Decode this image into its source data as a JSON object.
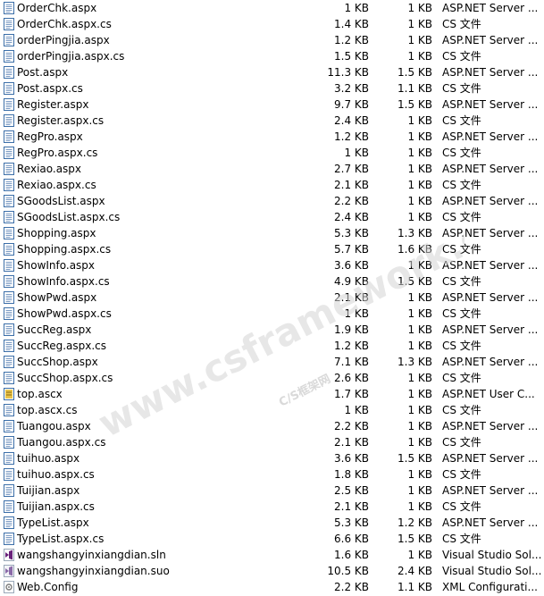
{
  "files": [
    {
      "name": "OrderChk.aspx",
      "size": "1 KB",
      "compressed": "1 KB",
      "type": "ASP.NET Server ...",
      "icon": "aspx-file-icon"
    },
    {
      "name": "OrderChk.aspx.cs",
      "size": "1.4 KB",
      "compressed": "1 KB",
      "type": "CS 文件",
      "icon": "cs-file-icon"
    },
    {
      "name": "orderPingjia.aspx",
      "size": "1.2 KB",
      "compressed": "1 KB",
      "type": "ASP.NET Server ...",
      "icon": "aspx-file-icon"
    },
    {
      "name": "orderPingjia.aspx.cs",
      "size": "1.5 KB",
      "compressed": "1 KB",
      "type": "CS 文件",
      "icon": "cs-file-icon"
    },
    {
      "name": "Post.aspx",
      "size": "11.3 KB",
      "compressed": "1.5 KB",
      "type": "ASP.NET Server ...",
      "icon": "aspx-file-icon"
    },
    {
      "name": "Post.aspx.cs",
      "size": "3.2 KB",
      "compressed": "1.1 KB",
      "type": "CS 文件",
      "icon": "cs-file-icon"
    },
    {
      "name": "Register.aspx",
      "size": "9.7 KB",
      "compressed": "1.5 KB",
      "type": "ASP.NET Server ...",
      "icon": "aspx-file-icon"
    },
    {
      "name": "Register.aspx.cs",
      "size": "2.4 KB",
      "compressed": "1 KB",
      "type": "CS 文件",
      "icon": "cs-file-icon"
    },
    {
      "name": "RegPro.aspx",
      "size": "1.2 KB",
      "compressed": "1 KB",
      "type": "ASP.NET Server ...",
      "icon": "aspx-file-icon"
    },
    {
      "name": "RegPro.aspx.cs",
      "size": "1 KB",
      "compressed": "1 KB",
      "type": "CS 文件",
      "icon": "cs-file-icon"
    },
    {
      "name": "Rexiao.aspx",
      "size": "2.7 KB",
      "compressed": "1 KB",
      "type": "ASP.NET Server ...",
      "icon": "aspx-file-icon"
    },
    {
      "name": "Rexiao.aspx.cs",
      "size": "2.1 KB",
      "compressed": "1 KB",
      "type": "CS 文件",
      "icon": "cs-file-icon"
    },
    {
      "name": "SGoodsList.aspx",
      "size": "2.2 KB",
      "compressed": "1 KB",
      "type": "ASP.NET Server ...",
      "icon": "aspx-file-icon"
    },
    {
      "name": "SGoodsList.aspx.cs",
      "size": "2.4 KB",
      "compressed": "1 KB",
      "type": "CS 文件",
      "icon": "cs-file-icon"
    },
    {
      "name": "Shopping.aspx",
      "size": "5.3 KB",
      "compressed": "1.3 KB",
      "type": "ASP.NET Server ...",
      "icon": "aspx-file-icon"
    },
    {
      "name": "Shopping.aspx.cs",
      "size": "5.7 KB",
      "compressed": "1.6 KB",
      "type": "CS 文件",
      "icon": "cs-file-icon"
    },
    {
      "name": "ShowInfo.aspx",
      "size": "3.6 KB",
      "compressed": "1 KB",
      "type": "ASP.NET Server ...",
      "icon": "aspx-file-icon"
    },
    {
      "name": "ShowInfo.aspx.cs",
      "size": "4.9 KB",
      "compressed": "1.5 KB",
      "type": "CS 文件",
      "icon": "cs-file-icon"
    },
    {
      "name": "ShowPwd.aspx",
      "size": "2.1 KB",
      "compressed": "1 KB",
      "type": "ASP.NET Server ...",
      "icon": "aspx-file-icon"
    },
    {
      "name": "ShowPwd.aspx.cs",
      "size": "1 KB",
      "compressed": "1 KB",
      "type": "CS 文件",
      "icon": "cs-file-icon"
    },
    {
      "name": "SuccReg.aspx",
      "size": "1.9 KB",
      "compressed": "1 KB",
      "type": "ASP.NET Server ...",
      "icon": "aspx-file-icon"
    },
    {
      "name": "SuccReg.aspx.cs",
      "size": "1.2 KB",
      "compressed": "1 KB",
      "type": "CS 文件",
      "icon": "cs-file-icon"
    },
    {
      "name": "SuccShop.aspx",
      "size": "7.1 KB",
      "compressed": "1.3 KB",
      "type": "ASP.NET Server ...",
      "icon": "aspx-file-icon"
    },
    {
      "name": "SuccShop.aspx.cs",
      "size": "2.6 KB",
      "compressed": "1 KB",
      "type": "CS 文件",
      "icon": "cs-file-icon"
    },
    {
      "name": "top.ascx",
      "size": "1.7 KB",
      "compressed": "1 KB",
      "type": "ASP.NET User C...",
      "icon": "ascx-file-icon"
    },
    {
      "name": "top.ascx.cs",
      "size": "1 KB",
      "compressed": "1 KB",
      "type": "CS 文件",
      "icon": "cs-file-icon"
    },
    {
      "name": "Tuangou.aspx",
      "size": "2.2 KB",
      "compressed": "1 KB",
      "type": "ASP.NET Server ...",
      "icon": "aspx-file-icon"
    },
    {
      "name": "Tuangou.aspx.cs",
      "size": "2.1 KB",
      "compressed": "1 KB",
      "type": "CS 文件",
      "icon": "cs-file-icon"
    },
    {
      "name": "tuihuo.aspx",
      "size": "3.6 KB",
      "compressed": "1.5 KB",
      "type": "ASP.NET Server ...",
      "icon": "aspx-file-icon"
    },
    {
      "name": "tuihuo.aspx.cs",
      "size": "1.8 KB",
      "compressed": "1 KB",
      "type": "CS 文件",
      "icon": "cs-file-icon"
    },
    {
      "name": "Tuijian.aspx",
      "size": "2.5 KB",
      "compressed": "1 KB",
      "type": "ASP.NET Server ...",
      "icon": "aspx-file-icon"
    },
    {
      "name": "Tuijian.aspx.cs",
      "size": "2.1 KB",
      "compressed": "1 KB",
      "type": "CS 文件",
      "icon": "cs-file-icon"
    },
    {
      "name": "TypeList.aspx",
      "size": "5.3 KB",
      "compressed": "1.2 KB",
      "type": "ASP.NET Server ...",
      "icon": "aspx-file-icon"
    },
    {
      "name": "TypeList.aspx.cs",
      "size": "6.6 KB",
      "compressed": "1.5 KB",
      "type": "CS 文件",
      "icon": "cs-file-icon"
    },
    {
      "name": "wangshangyinxiangdian.sln",
      "size": "1.6 KB",
      "compressed": "1 KB",
      "type": "Visual Studio Sol...",
      "icon": "sln-file-icon"
    },
    {
      "name": "wangshangyinxiangdian.suo",
      "size": "10.5 KB",
      "compressed": "2.4 KB",
      "type": "Visual Studio Sol...",
      "icon": "suo-file-icon"
    },
    {
      "name": "Web.Config",
      "size": "2.2 KB",
      "compressed": "1.1 KB",
      "type": "XML Configurati...",
      "icon": "config-file-icon"
    }
  ],
  "watermark": {
    "main": "www.csframework.com",
    "sub": "C/S框架网"
  },
  "colors": {
    "icon_blue": "#3b6ea8",
    "icon_line": "#7d9cc4",
    "icon_yellow": "#e8c34a",
    "vs_purple": "#68217a",
    "watermark": "#cfcfcf"
  }
}
